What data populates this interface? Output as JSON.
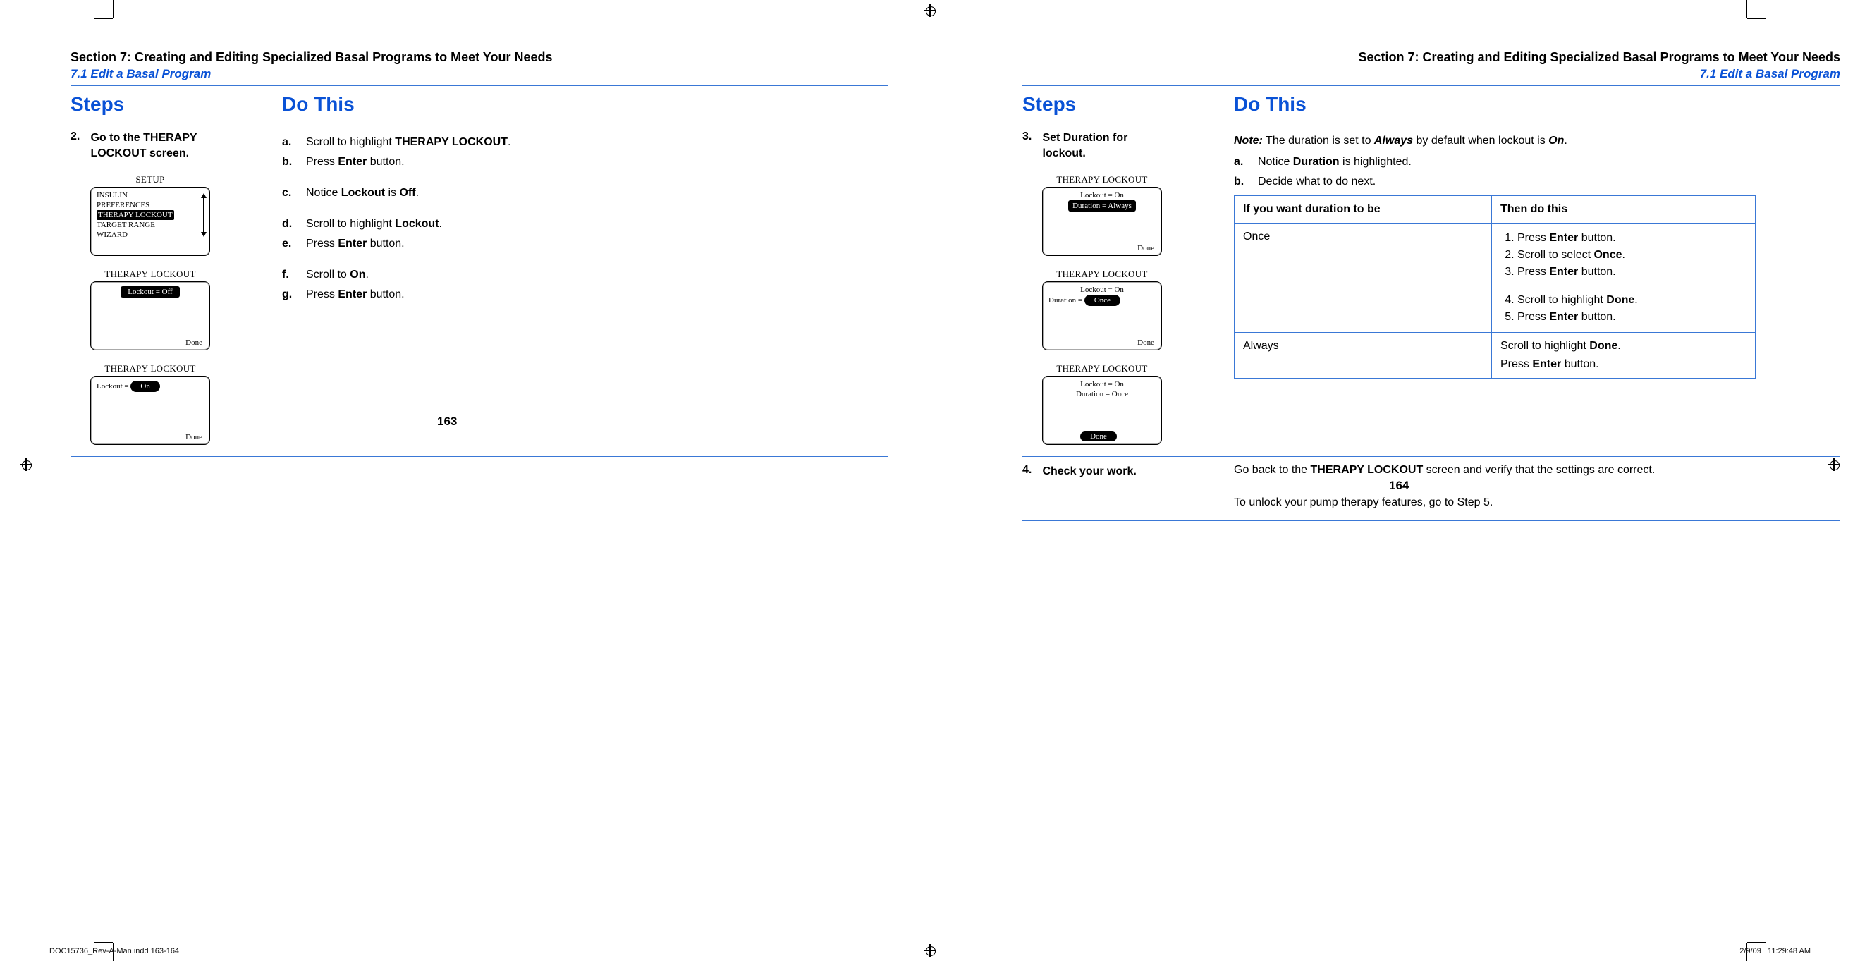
{
  "meta": {
    "section_title": "Section 7: Creating and Editing Specialized Basal Programs to Meet Your Needs",
    "subsection": "7.1 Edit a Basal Program",
    "page_left": "163",
    "page_right": "164",
    "slug_left": "DOC15736_Rev-A-Man.indd   163-164",
    "slug_right_date": "2/9/09",
    "slug_right_time": "11:29:48 AM"
  },
  "headers": {
    "steps": "Steps",
    "dothis": "Do This"
  },
  "left": {
    "step_num": "2.",
    "step_text_1": "Go to the THERAPY",
    "step_text_2": "LOCKOUT screen.",
    "subs": {
      "a": {
        "l": "a.",
        "t1": "Scroll to highlight ",
        "b": "THERAPY LOCKOUT",
        "t2": "."
      },
      "b": {
        "l": "b.",
        "t1": "Press ",
        "b": "Enter",
        "t2": " button."
      },
      "c": {
        "l": "c.",
        "t1": "Notice ",
        "b": "Lockout",
        "t2": " is ",
        "b2": "Off",
        "t3": "."
      },
      "d": {
        "l": "d.",
        "t1": "Scroll to highlight ",
        "b": "Lockout",
        "t2": "."
      },
      "e": {
        "l": "e.",
        "t1": "Press ",
        "b": "Enter",
        "t2": " button."
      },
      "f": {
        "l": "f.",
        "t1": "Scroll to ",
        "b": "On",
        "t2": "."
      },
      "g": {
        "l": "g.",
        "t1": "Press ",
        "b": "Enter",
        "t2": " button."
      }
    },
    "screens": {
      "s1": {
        "title": "SETUP",
        "items": [
          "INSULIN",
          "PREFERENCES",
          "THERAPY LOCKOUT",
          "TARGET RANGE",
          "WIZARD"
        ],
        "hl": 2,
        "footer": "",
        "arrows": true
      },
      "s2": {
        "title": "THERAPY LOCKOUT",
        "line": "Lockout = Off",
        "pill": true,
        "footer": "Done"
      },
      "s3": {
        "title": "THERAPY LOCKOUT",
        "prefix": "Lockout = ",
        "pillText": "On",
        "footer": "Done"
      }
    }
  },
  "right": {
    "step3_num": "3.",
    "step3_text_1": "Set Duration for",
    "step3_text_2": "lockout.",
    "note_lead": "Note:",
    "note_mid": " The duration is set to ",
    "note_b1": "Always",
    "note_mid2": " by default when lockout is ",
    "note_b2": "On",
    "note_end": ".",
    "subs": {
      "a": {
        "l": "a.",
        "t1": "Notice ",
        "b": "Duration",
        "t2": " is highlighted."
      },
      "b": {
        "l": "b.",
        "t": "Decide what to do next."
      }
    },
    "opt_head_l": "If you want duration to be",
    "opt_head_r": "Then do this",
    "opt_once": "Once",
    "opt_always": "Always",
    "once_steps": {
      "1": {
        "t1": "Press ",
        "b": "Enter",
        "t2": " button."
      },
      "2": {
        "t1": "Scroll to select ",
        "b": "Once",
        "t2": "."
      },
      "3": {
        "t1": "Press ",
        "b": "Enter",
        "t2": " button."
      },
      "4": {
        "t1": "Scroll to highlight ",
        "b": "Done",
        "t2": "."
      },
      "5": {
        "t1": "Press ",
        "b": "Enter",
        "t2": " button."
      }
    },
    "always_l1_a": "Scroll to highlight ",
    "always_l1_b": "Done",
    "always_l1_c": ".",
    "always_l2_a": "Press ",
    "always_l2_b": "Enter",
    "always_l2_c": " button.",
    "screens": {
      "s1": {
        "title": "THERAPY LOCKOUT",
        "l1": "Lockout = On",
        "l2": "Duration = Always",
        "hl": 2,
        "footer": "Done"
      },
      "s2": {
        "title": "THERAPY LOCKOUT",
        "l1": "Lockout = On",
        "prefix": "Duration = ",
        "pillText": "Once",
        "footer": "Done"
      },
      "s3": {
        "title": "THERAPY LOCKOUT",
        "l1": "Lockout = On",
        "l2": "Duration = Once",
        "footerPill": "Done"
      }
    },
    "step4_num": "4.",
    "step4_text": "Check your work.",
    "step4_do_a": "Go back to the ",
    "step4_do_b": "THERAPY LOCKOUT",
    "step4_do_c": " screen and verify that the settings are correct.",
    "step4_tail": "To unlock your pump therapy features, go to Step 5."
  }
}
